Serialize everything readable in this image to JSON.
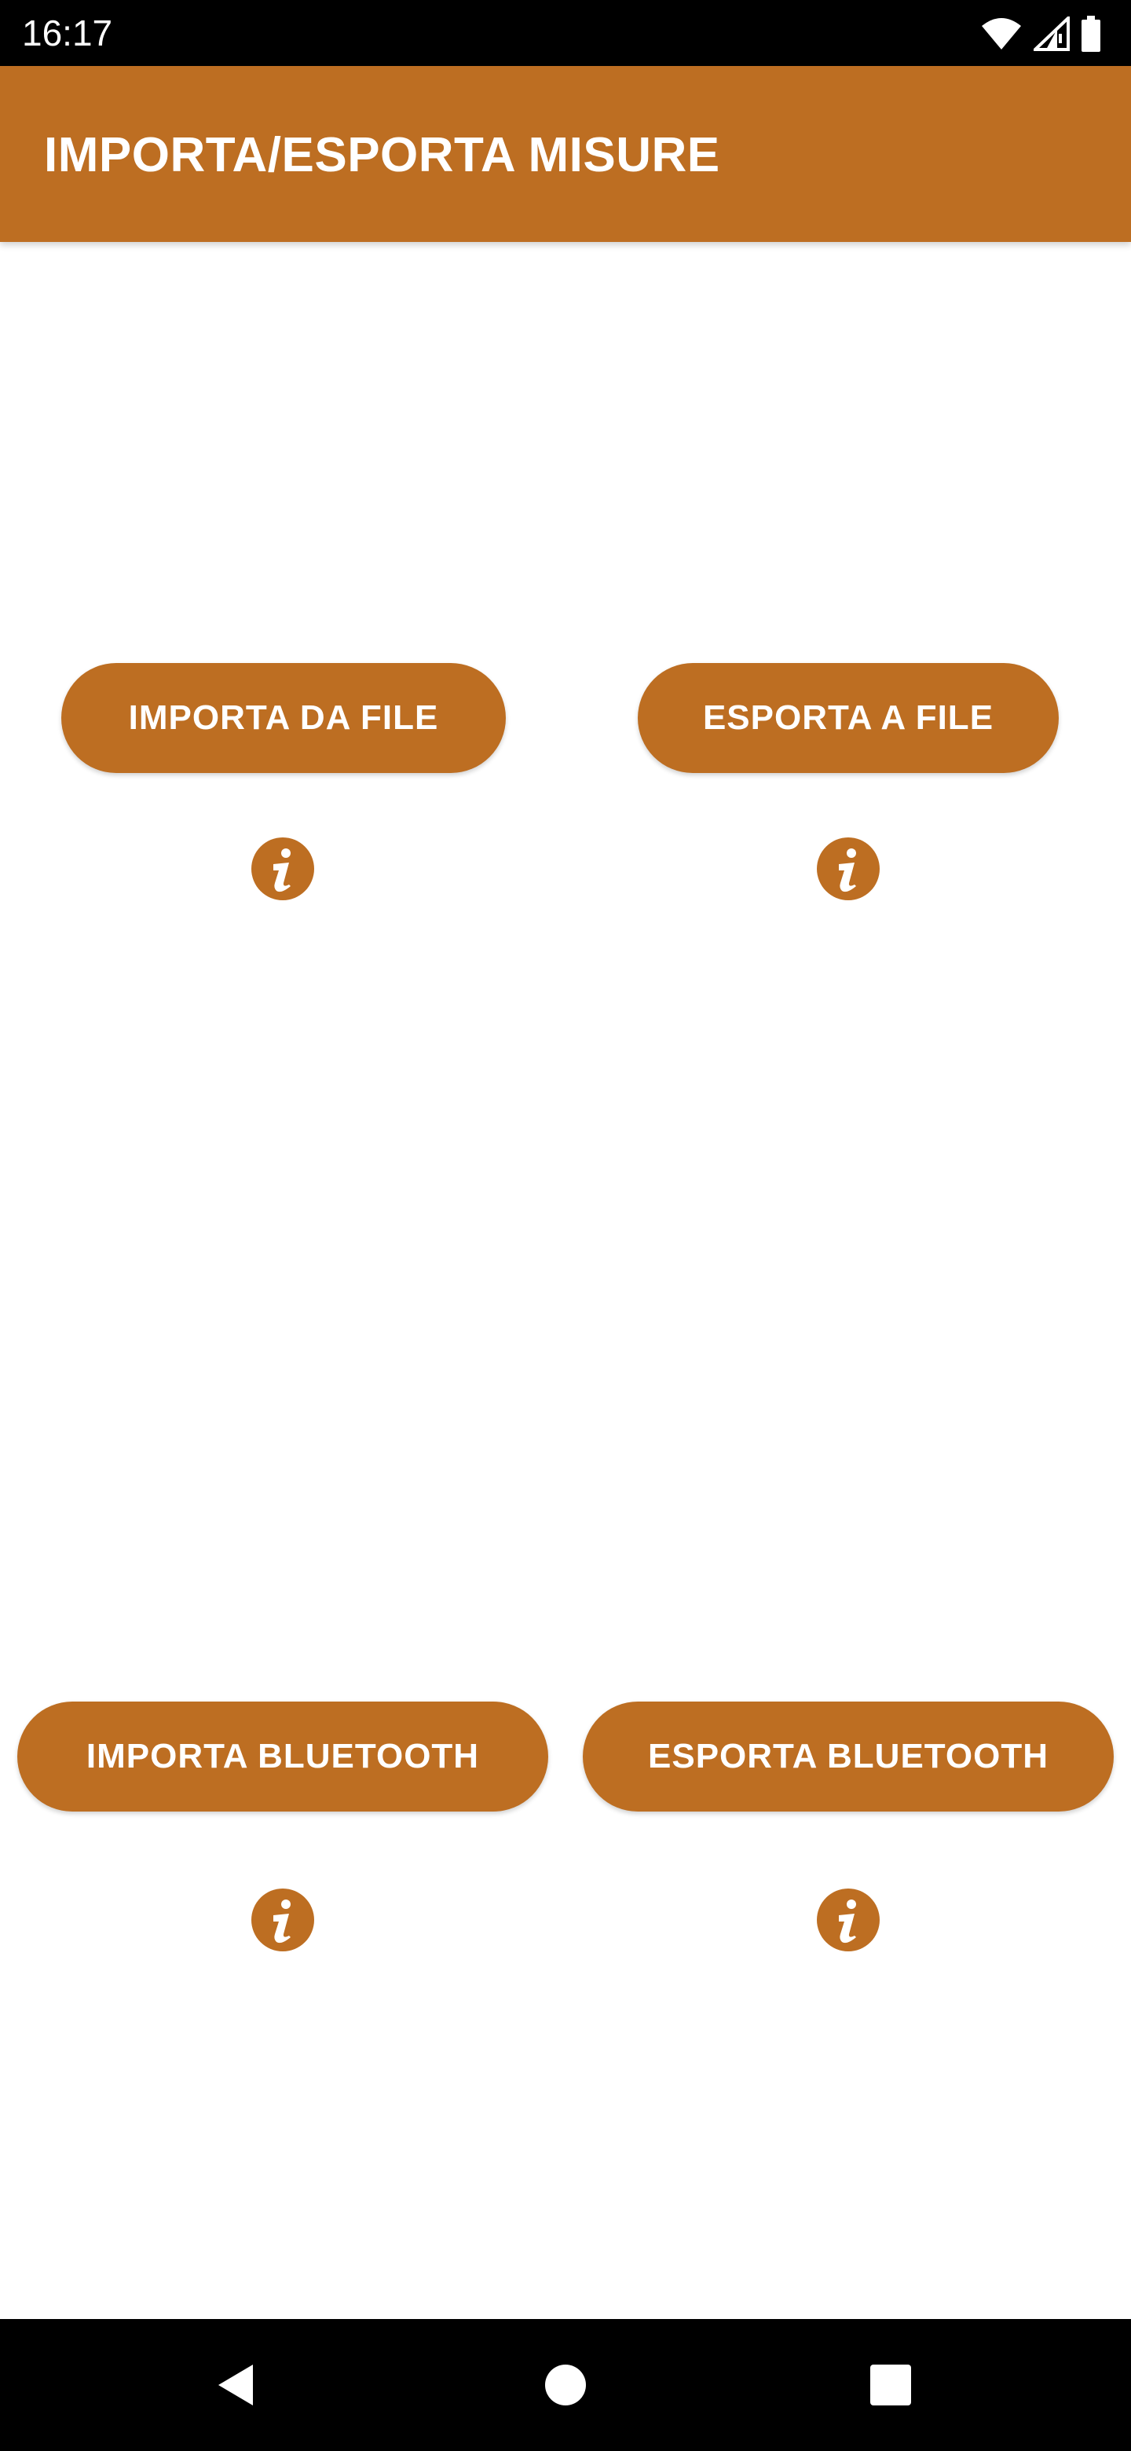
{
  "status_bar": {
    "time": "16:17",
    "icons": [
      "wifi-icon",
      "signal-icon",
      "battery-icon"
    ]
  },
  "app_bar": {
    "title": "IMPORTA/ESPORTA MISURE",
    "color": "#bd6e22"
  },
  "buttons": {
    "import_file": "IMPORTA DA FILE",
    "export_file": "ESPORTA A FILE",
    "import_bluetooth": "IMPORTA BLUETOOTH",
    "export_bluetooth": "ESPORTA BLUETOOTH"
  },
  "info_icons": [
    "info-icon",
    "info-icon",
    "info-icon",
    "info-icon"
  ],
  "nav_bar": {
    "icons": [
      "back-icon",
      "home-icon",
      "recents-icon"
    ]
  }
}
